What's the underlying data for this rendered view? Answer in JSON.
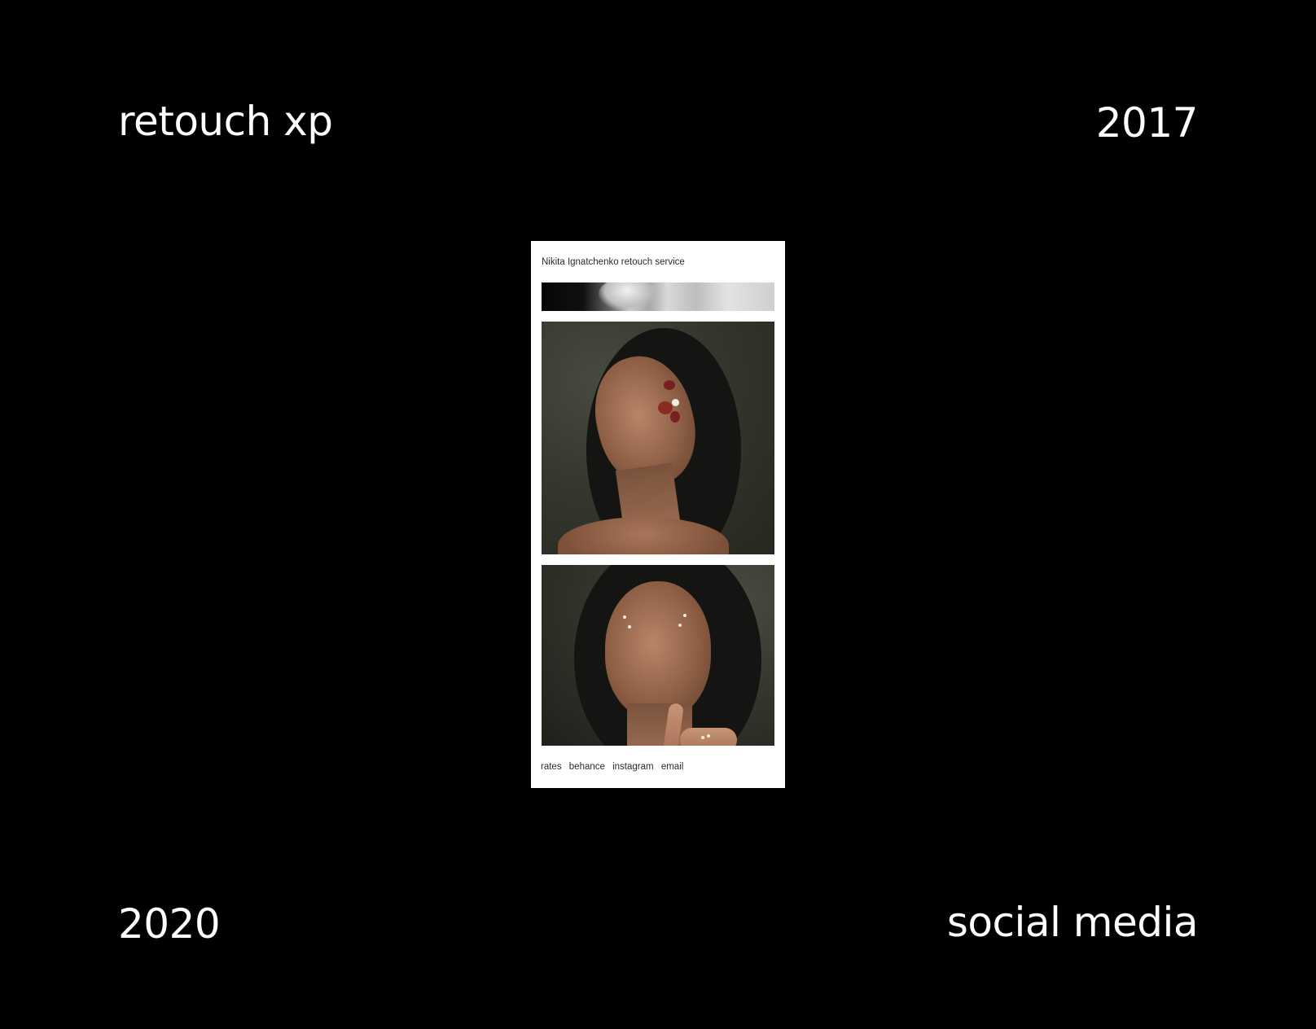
{
  "corners": {
    "top_left": "retouch xp",
    "top_right": "2017",
    "bottom_left": "2020",
    "bottom_right": "social media"
  },
  "phone": {
    "site_title": "Nikita Ignatchenko retouch service",
    "footer_links": [
      "rates",
      "behance",
      "instagram",
      "email"
    ]
  },
  "colors": {
    "background": "#000000",
    "text": "#ffffff",
    "phone_bg": "#ffffff",
    "phone_text": "#2a2a2a"
  }
}
